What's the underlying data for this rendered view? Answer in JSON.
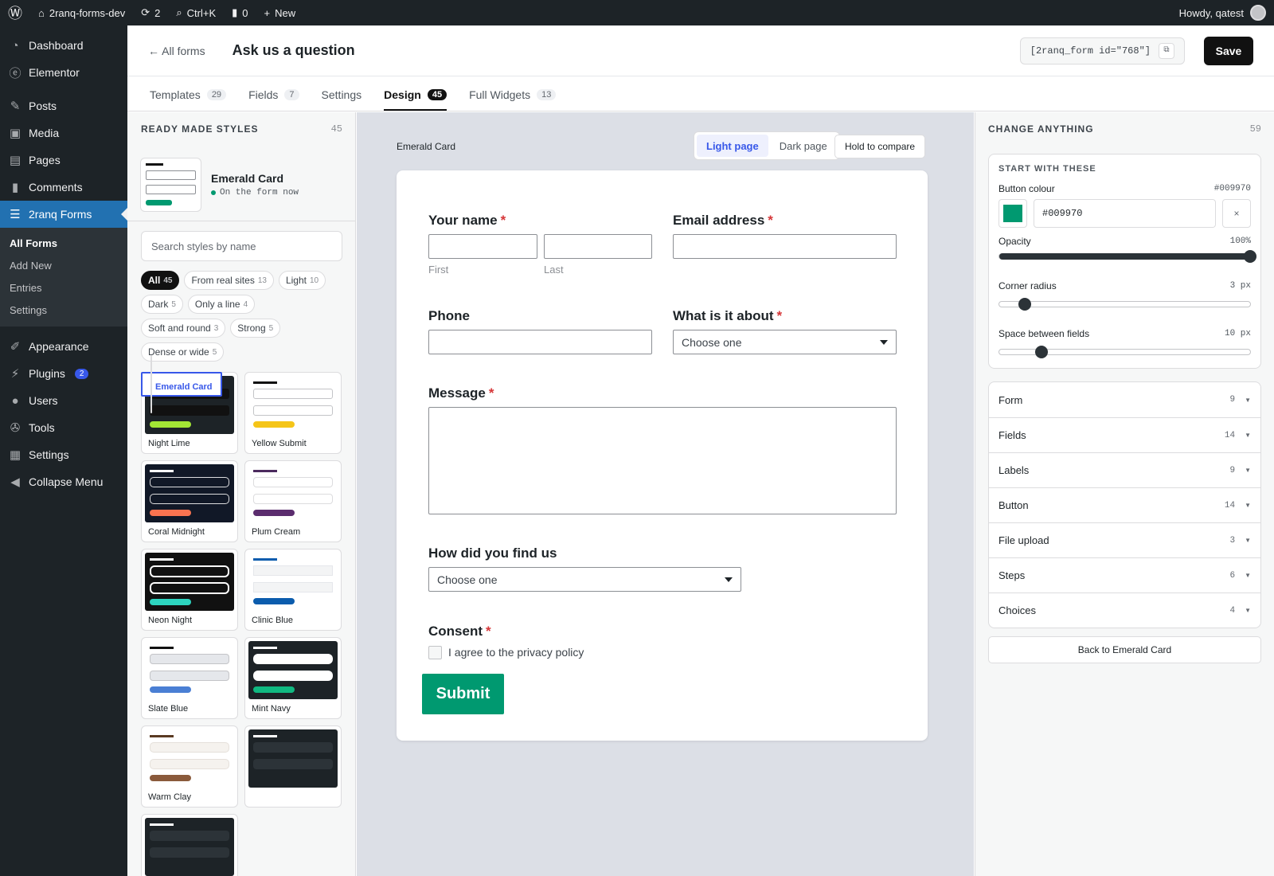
{
  "admin_bar": {
    "site": "2ranq-forms-dev",
    "updates": "2",
    "search": "Ctrl+K",
    "comments": "0",
    "new": "New",
    "howdy": "Howdy, qatest"
  },
  "sidebar": {
    "items": [
      {
        "label": "Dashboard",
        "icon": "dashboard-icon"
      },
      {
        "label": "Elementor",
        "icon": "elementor-icon"
      },
      {
        "label": "Posts",
        "icon": "pin-icon"
      },
      {
        "label": "Media",
        "icon": "media-icon"
      },
      {
        "label": "Pages",
        "icon": "pages-icon"
      },
      {
        "label": "Comments",
        "icon": "comments-icon"
      },
      {
        "label": "2ranq Forms",
        "icon": "forms-icon"
      },
      {
        "label": "Appearance",
        "icon": "brush-icon"
      },
      {
        "label": "Plugins",
        "icon": "plugin-icon",
        "badge": "2"
      },
      {
        "label": "Users",
        "icon": "users-icon"
      },
      {
        "label": "Tools",
        "icon": "wrench-icon"
      },
      {
        "label": "Settings",
        "icon": "settings-icon"
      },
      {
        "label": "Collapse Menu",
        "icon": "collapse-icon"
      }
    ],
    "submenu": [
      "All Forms",
      "Add New",
      "Entries",
      "Settings"
    ]
  },
  "header": {
    "back": "← All forms",
    "title": "Ask us a question",
    "shortcode": "[2ranq_form id=\"768\"]",
    "save": "Save"
  },
  "tabs": [
    {
      "label": "Templates",
      "count": "29"
    },
    {
      "label": "Fields",
      "count": "7"
    },
    {
      "label": "Settings",
      "count": ""
    },
    {
      "label": "Design",
      "count": "45"
    },
    {
      "label": "Full Widgets",
      "count": "13"
    }
  ],
  "left_panel": {
    "title": "READY MADE STYLES",
    "count": "45",
    "current_name": "Emerald Card",
    "current_status": "On the form now",
    "search_placeholder": "Search styles by name",
    "filters": [
      {
        "label": "All",
        "count": "45"
      },
      {
        "label": "From real sites",
        "count": "13"
      },
      {
        "label": "Light",
        "count": "10"
      },
      {
        "label": "Dark",
        "count": "5"
      },
      {
        "label": "Only a line",
        "count": "4"
      },
      {
        "label": "Soft and round",
        "count": "3"
      },
      {
        "label": "Strong",
        "count": "5"
      },
      {
        "label": "Dense or wide",
        "count": "5"
      }
    ],
    "styles": [
      "Night Lime",
      "Yellow Submit",
      "Coral Midnight",
      "Plum Cream",
      "Neon Night",
      "Clinic Blue",
      "Slate Blue",
      "Mint Navy",
      "Warm Clay",
      "Emerald Card",
      "",
      ""
    ]
  },
  "canvas": {
    "style_name": "Emerald Card",
    "light": "Light page",
    "dark": "Dark page",
    "hold": "Hold to compare"
  },
  "form": {
    "name_label": "Your name",
    "first": "First",
    "last": "Last",
    "email_label": "Email address",
    "phone_label": "Phone",
    "about_label": "What is it about",
    "about_placeholder": "Choose one",
    "message_label": "Message",
    "find_label": "How did you find us",
    "find_placeholder": "Choose one",
    "consent_label": "Consent",
    "consent_text": "I agree to the privacy policy",
    "submit": "Submit",
    "req": "*"
  },
  "right_panel": {
    "title": "CHANGE ANYTHING",
    "count": "59",
    "start_title": "START WITH THESE",
    "button_colour_label": "Button colour",
    "button_colour": "#009970",
    "clear": "×",
    "opacity_label": "Opacity",
    "opacity": "100%",
    "opacity_value": 1.0,
    "radius_label": "Corner radius",
    "radius": "3 px",
    "radius_value": 3,
    "space_label": "Space between fields",
    "space": "10 px",
    "space_value": 10,
    "sections": [
      {
        "label": "Form",
        "count": "9"
      },
      {
        "label": "Fields",
        "count": "14"
      },
      {
        "label": "Labels",
        "count": "9"
      },
      {
        "label": "Button",
        "count": "14"
      },
      {
        "label": "File upload",
        "count": "3"
      },
      {
        "label": "Steps",
        "count": "6"
      },
      {
        "label": "Choices",
        "count": "4"
      }
    ],
    "back": "Back to Emerald Card"
  }
}
